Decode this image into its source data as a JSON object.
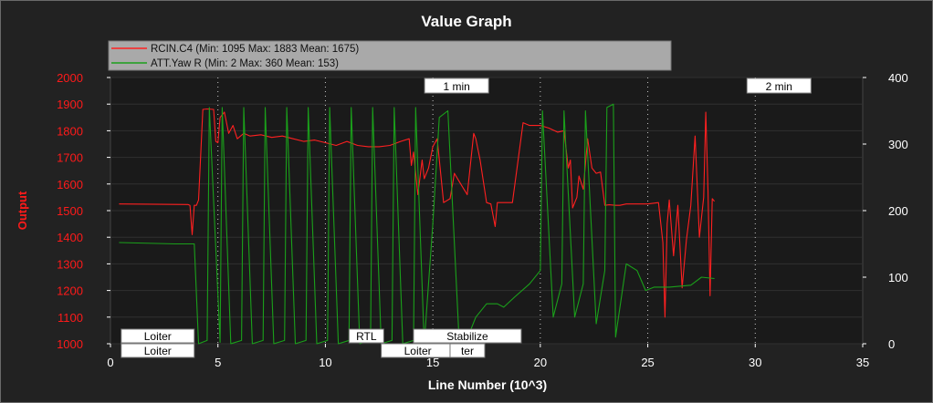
{
  "chart_data": {
    "type": "line",
    "title": "Value Graph",
    "xlabel": "Line Number (10^3)",
    "ylabel": "Output",
    "xlim": [
      0,
      35
    ],
    "ylim": [
      1000,
      2000
    ],
    "y2lim": [
      0,
      400
    ],
    "x_ticks": [
      "0",
      "5",
      "10",
      "15",
      "20",
      "25",
      "30",
      "35"
    ],
    "y_ticks": [
      "1000",
      "1100",
      "1200",
      "1300",
      "1400",
      "1500",
      "1600",
      "1700",
      "1800",
      "1900",
      "2000"
    ],
    "y2_ticks": [
      "0",
      "100",
      "200",
      "300",
      "400"
    ],
    "grid": true,
    "legend_position": "top-left",
    "time_markers": [
      {
        "x": 5,
        "label": ""
      },
      {
        "x": 10,
        "label": ""
      },
      {
        "x": 15,
        "label": "1 min"
      },
      {
        "x": 20,
        "label": ""
      },
      {
        "x": 25,
        "label": ""
      },
      {
        "x": 30,
        "label": "2 min"
      }
    ],
    "mode_labels": [
      {
        "x": 0.5,
        "row": 0,
        "label": "Loiter"
      },
      {
        "x": 0.5,
        "row": 1,
        "label": "Loiter"
      },
      {
        "x": 11.1,
        "row": 0,
        "label": "RTL"
      },
      {
        "x": 14.1,
        "row": 0,
        "label": "Stabilize"
      },
      {
        "x": 12.6,
        "row": 1,
        "label": "Loiter"
      },
      {
        "x": 15.8,
        "row": 1,
        "label": "ter"
      }
    ],
    "series": [
      {
        "name": "RCIN.C4 (Min: 1095 Max: 1883 Mean: 1675)",
        "color": "#ff2020",
        "axis": "left",
        "x": [
          0.4,
          3.6,
          3.7,
          3.8,
          3.9,
          4.0,
          4.1,
          4.3,
          4.5,
          4.8,
          4.9,
          5.0,
          5.1,
          5.3,
          5.5,
          5.7,
          5.9,
          6.2,
          6.5,
          7.0,
          7.5,
          8.0,
          8.5,
          9.0,
          9.5,
          10.0,
          10.5,
          11.0,
          11.5,
          12.0,
          12.5,
          13.0,
          13.5,
          13.9,
          14.0,
          14.1,
          14.3,
          14.5,
          14.6,
          14.8,
          15.0,
          15.2,
          15.5,
          15.8,
          16.0,
          16.3,
          16.6,
          16.9,
          17.0,
          17.2,
          17.5,
          17.7,
          17.9,
          18.0,
          18.2,
          18.7,
          19.2,
          19.5,
          20.0,
          20.4,
          20.8,
          21.1,
          21.3,
          21.4,
          21.5,
          21.7,
          21.8,
          22.0,
          22.2,
          22.4,
          22.6,
          22.8,
          23.0,
          23.2,
          23.5,
          23.7,
          24.0,
          25.0,
          25.5,
          25.7,
          25.8,
          25.9,
          26.0,
          26.2,
          26.4,
          26.6,
          26.8,
          27.0,
          27.2,
          27.4,
          27.6,
          27.7,
          27.8,
          27.9,
          28.0,
          28.1
        ],
        "values": [
          1525,
          1523,
          1520,
          1410,
          1520,
          1520,
          1540,
          1880,
          1882,
          1880,
          1760,
          1755,
          1850,
          1870,
          1790,
          1820,
          1770,
          1790,
          1780,
          1785,
          1775,
          1780,
          1770,
          1760,
          1765,
          1755,
          1745,
          1760,
          1745,
          1740,
          1740,
          1745,
          1760,
          1770,
          1670,
          1720,
          1560,
          1690,
          1620,
          1660,
          1740,
          1770,
          1530,
          1545,
          1640,
          1600,
          1560,
          1790,
          1770,
          1690,
          1530,
          1525,
          1440,
          1530,
          1530,
          1530,
          1830,
          1820,
          1820,
          1810,
          1795,
          1800,
          1660,
          1690,
          1510,
          1550,
          1630,
          1580,
          1770,
          1660,
          1640,
          1645,
          1520,
          1522,
          1520,
          1520,
          1525,
          1525,
          1530,
          1380,
          1100,
          1450,
          1540,
          1330,
          1520,
          1210,
          1390,
          1520,
          1780,
          1400,
          1550,
          1870,
          1580,
          1180,
          1545,
          1535
        ]
      },
      {
        "name": "ATT.Yaw R (Min: 2 Max: 360 Mean: 153)",
        "color": "#1aa01a",
        "axis": "right",
        "x": [
          0.4,
          3.0,
          3.9,
          4.1,
          4.5,
          4.6,
          5.1,
          5.2,
          5.6,
          6.1,
          6.2,
          6.6,
          7.1,
          7.2,
          7.6,
          8.1,
          8.2,
          8.6,
          9.1,
          9.2,
          9.6,
          10.1,
          10.2,
          10.6,
          11.1,
          11.2,
          11.6,
          12.1,
          12.2,
          12.6,
          13.1,
          13.2,
          13.6,
          14.1,
          14.2,
          14.6,
          15.0,
          15.3,
          15.7,
          16.2,
          16.5,
          17.0,
          17.5,
          18.0,
          18.3,
          18.8,
          19.5,
          20.0,
          20.1,
          20.6,
          21.0,
          21.1,
          21.6,
          22.0,
          22.1,
          22.6,
          23.0,
          23.1,
          23.4,
          23.5,
          24.0,
          24.5,
          24.9,
          25.3,
          26.0,
          27.0,
          27.5,
          28.1
        ],
        "values": [
          152,
          150,
          150,
          0,
          5,
          355,
          2,
          355,
          0,
          5,
          355,
          0,
          5,
          355,
          0,
          5,
          355,
          0,
          5,
          355,
          0,
          5,
          355,
          0,
          5,
          355,
          0,
          5,
          355,
          0,
          5,
          355,
          0,
          5,
          355,
          0,
          180,
          340,
          350,
          20,
          0,
          40,
          60,
          60,
          55,
          70,
          90,
          110,
          350,
          40,
          90,
          350,
          40,
          90,
          350,
          30,
          110,
          355,
          360,
          10,
          120,
          110,
          80,
          85,
          85,
          88,
          100,
          98
        ]
      }
    ]
  }
}
